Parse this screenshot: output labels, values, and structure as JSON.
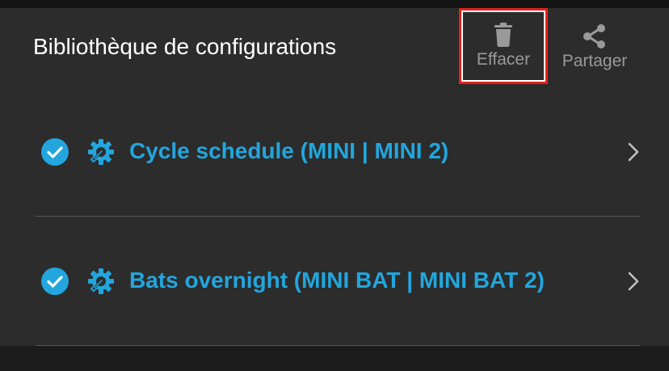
{
  "header": {
    "title": "Bibliothèque de configurations",
    "actions": {
      "delete_label": "Effacer",
      "share_label": "Partager"
    }
  },
  "list": {
    "items": [
      {
        "label": "Cycle schedule (MINI | MINI 2)",
        "selected": true,
        "icon": "gear-icon"
      },
      {
        "label": "Bats overnight (MINI BAT | MINI BAT 2)",
        "selected": true,
        "icon": "gear-icon"
      }
    ]
  },
  "colors": {
    "accent": "#22a6dd",
    "highlight_border": "#e2231a",
    "header_bg": "#2c2c2c",
    "app_bg": "#1c1c1c"
  }
}
